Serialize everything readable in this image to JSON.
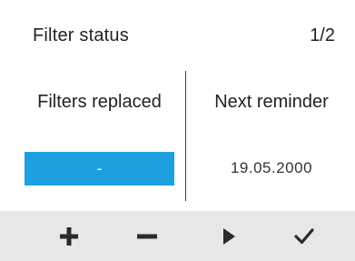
{
  "header": {
    "title": "Filter status",
    "page_indicator": "1/2"
  },
  "columns": {
    "left": {
      "label": "Filters replaced",
      "value": "-"
    },
    "right": {
      "label": "Next reminder",
      "value": "19.05.2000"
    }
  },
  "colors": {
    "accent": "#1e9fe0",
    "footer_background": "#e7e7e7",
    "icon": "#2b2b2b"
  },
  "footer": {
    "buttons": [
      {
        "icon": "plus-icon"
      },
      {
        "icon": "minus-icon"
      },
      {
        "icon": "play-right-icon"
      },
      {
        "icon": "checkmark-icon"
      }
    ]
  }
}
